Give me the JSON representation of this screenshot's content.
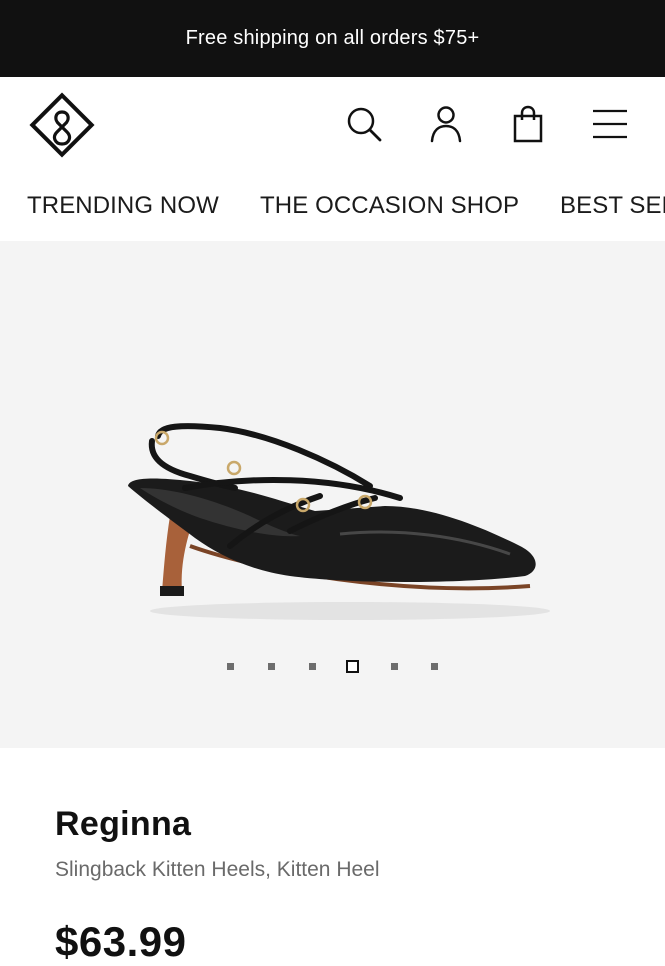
{
  "promo_bar": {
    "text": "Free shipping on all orders $75+"
  },
  "header": {
    "logo_icon": "brand-diamond-logo-icon",
    "icons": [
      "search-icon",
      "account-icon",
      "bag-icon",
      "menu-icon"
    ]
  },
  "nav": {
    "items": [
      {
        "label": "TRENDING NOW"
      },
      {
        "label": "THE OCCASION SHOP"
      },
      {
        "label": "BEST SELLERS"
      }
    ]
  },
  "gallery": {
    "image_count": 6,
    "active_index": 3
  },
  "product": {
    "name": "Reginna",
    "subtitle": "Slingback Kitten Heels, Kitten Heel",
    "price": "$63.99"
  },
  "colors": {
    "promo_bg": "#111111",
    "gallery_bg": "#f4f4f4",
    "text_secondary": "#6a6a6a"
  }
}
